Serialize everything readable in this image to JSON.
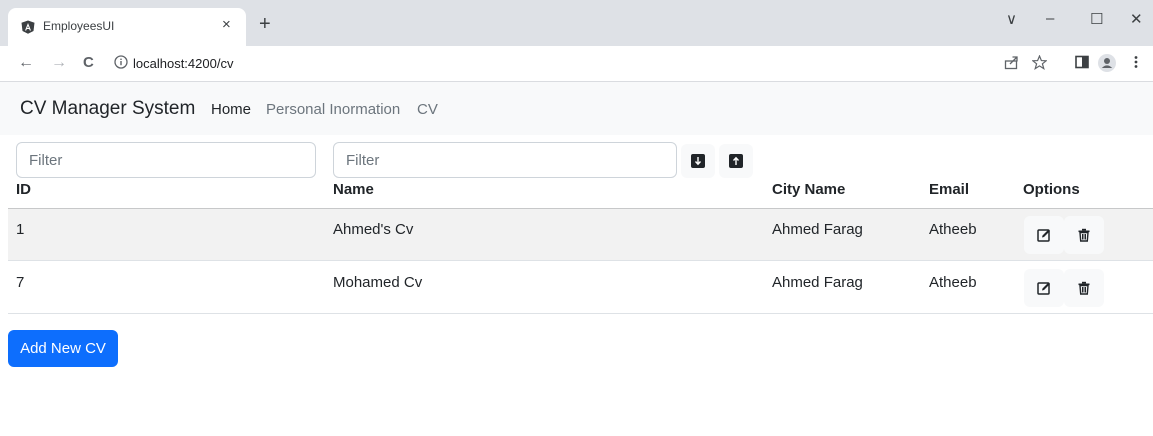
{
  "browser": {
    "tab_title": "EmployeesUI",
    "tab_close": "×",
    "new_tab": "+",
    "url": "localhost:4200/cv",
    "back": "←",
    "forward": "→",
    "reload": "C",
    "win_dropdown": "∨",
    "win_minimize": "–",
    "win_maximize": "☐",
    "win_close": "✕",
    "icons": [
      "angular-favicon",
      "info-icon",
      "share-icon",
      "star-icon",
      "side-panel-icon",
      "profile-icon",
      "menu-dots-icon"
    ]
  },
  "navbar": {
    "brand": "CV Manager System",
    "links": [
      {
        "label": "Home",
        "color": "#212529"
      },
      {
        "label": "Personal Inormation",
        "color": "#6c757d"
      },
      {
        "label": "CV",
        "color": "#6c757d"
      }
    ]
  },
  "filters": {
    "id_placeholder": "Filter",
    "name_placeholder": "Filter",
    "sort_desc_icon": "arrow-down-icon",
    "sort_asc_icon": "arrow-up-icon"
  },
  "table": {
    "headers": [
      "ID",
      "Name",
      "City Name",
      "Email",
      "Options"
    ],
    "rows": [
      {
        "id": "1",
        "name": "Ahmed's Cv",
        "city": "Ahmed Farag",
        "email": "Atheeb",
        "bg": "#f2f2f2"
      },
      {
        "id": "7",
        "name": "Mohamed Cv",
        "city": "Ahmed Farag",
        "email": "Atheeb",
        "bg": "#ffffff"
      }
    ],
    "option_icons": [
      "edit-icon",
      "trash-icon"
    ]
  },
  "actions": {
    "add_label": "Add New CV",
    "accent": "#0d6efd"
  }
}
